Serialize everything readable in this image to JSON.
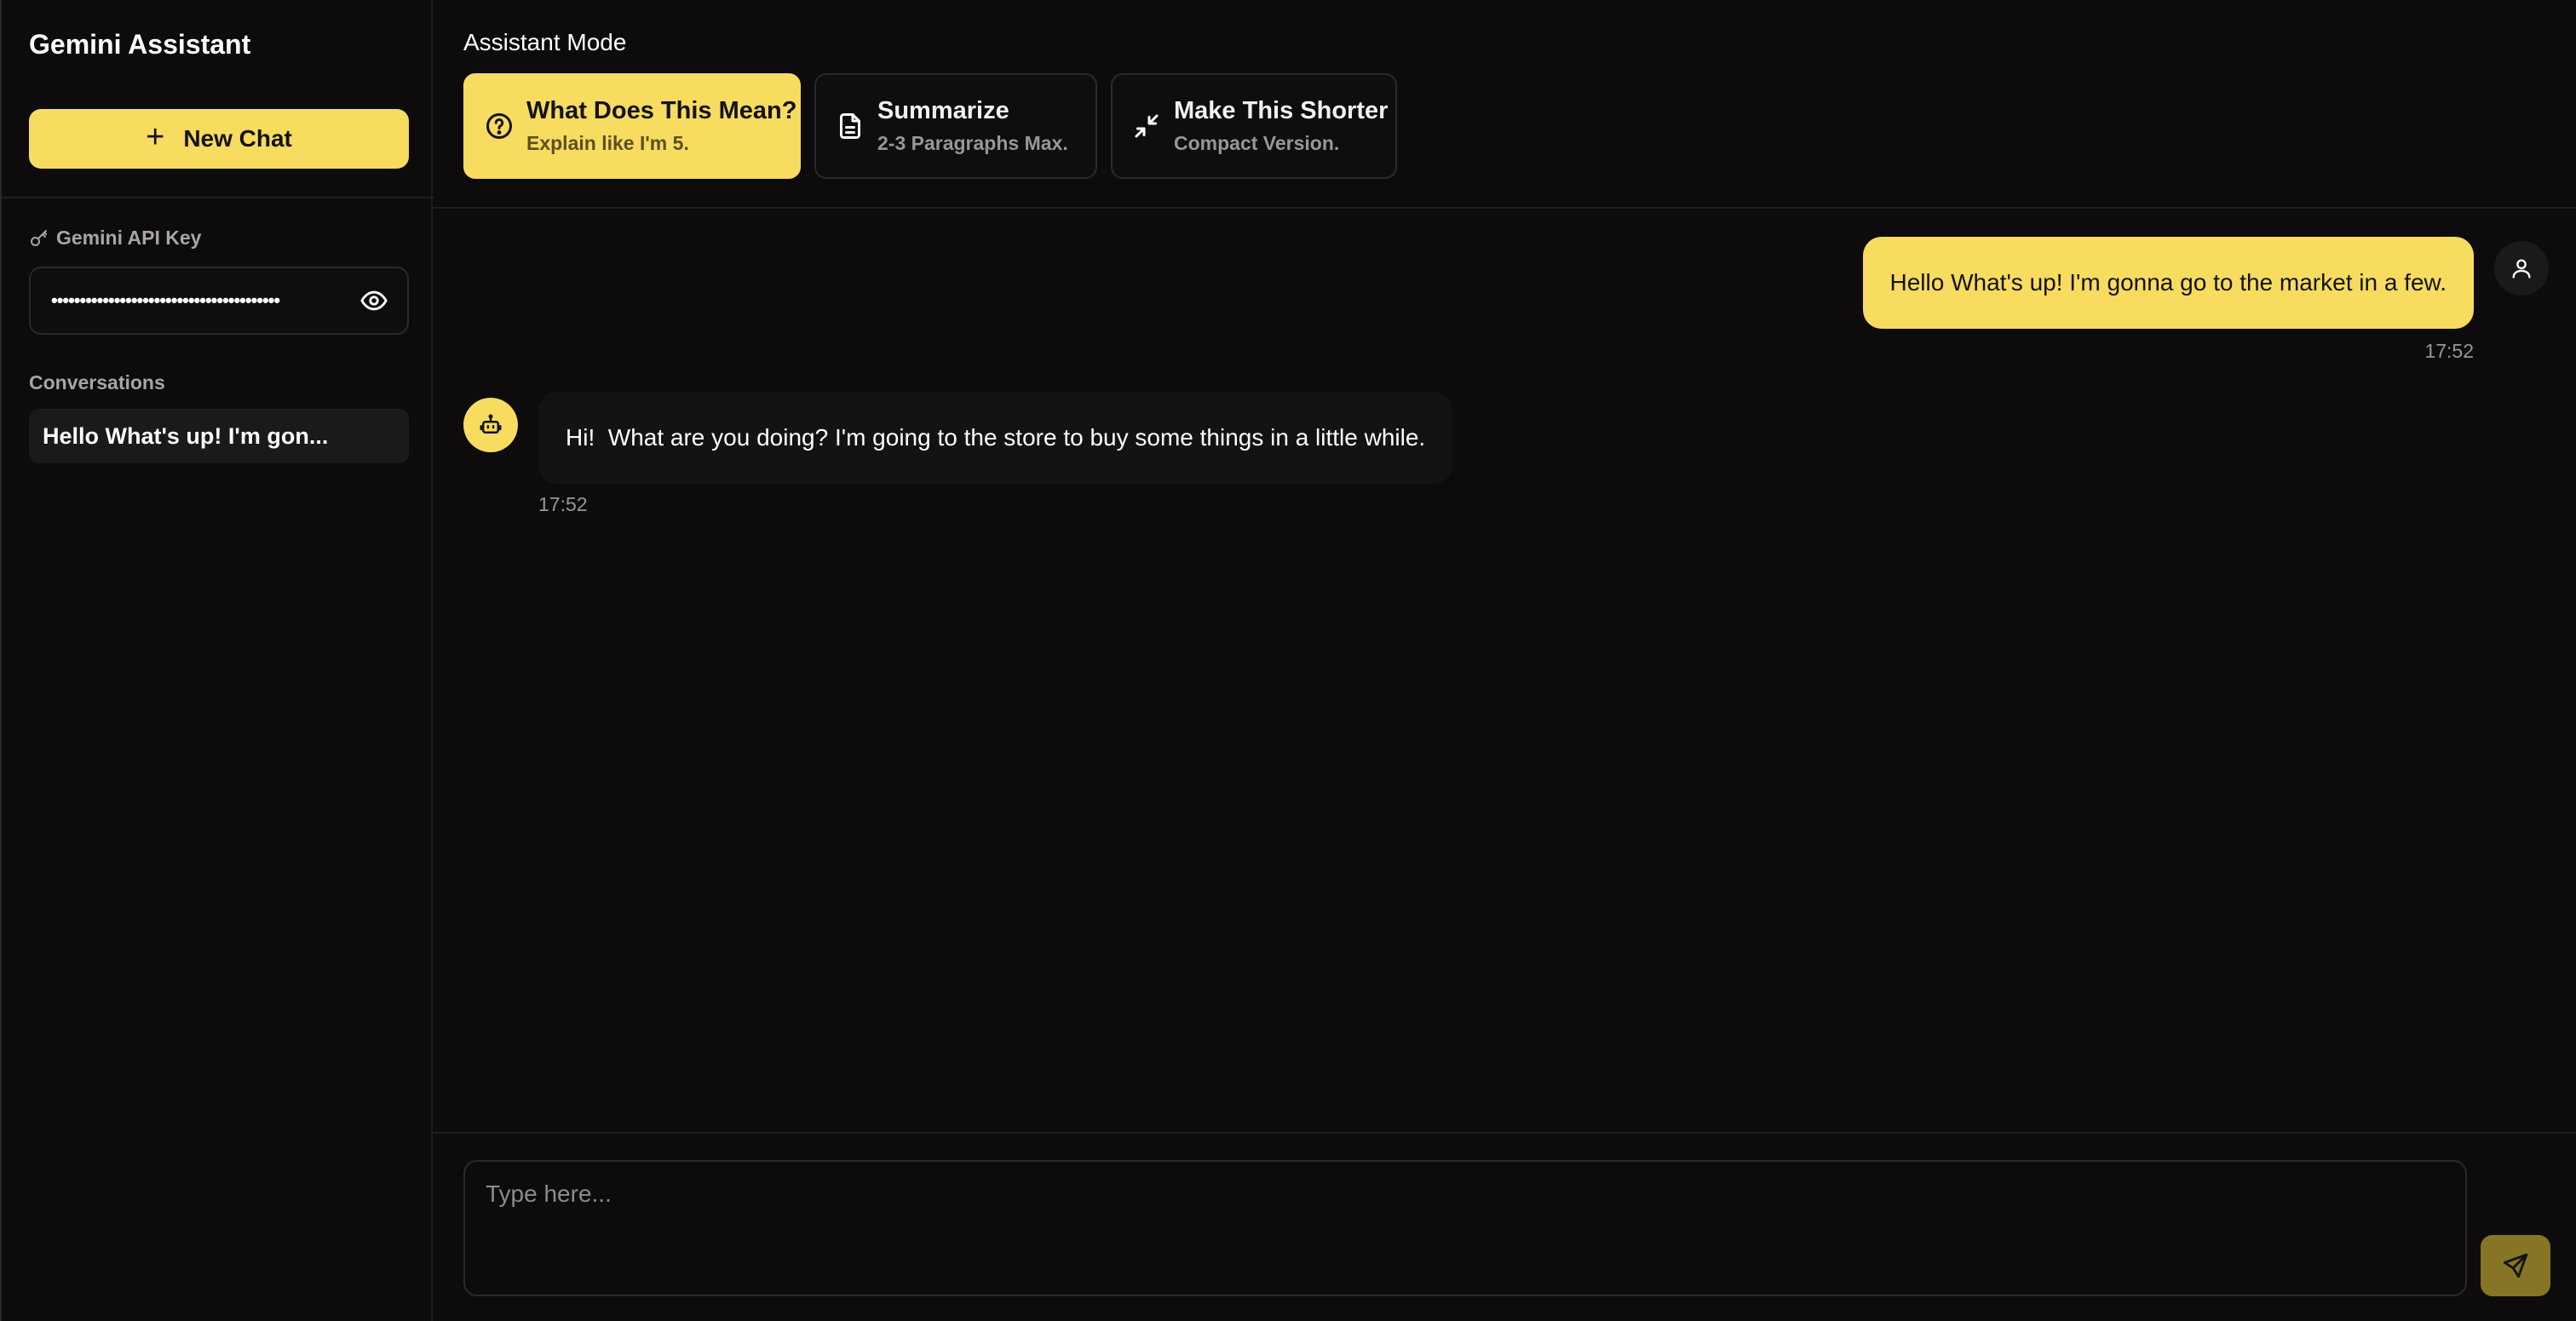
{
  "sidebar": {
    "title": "Gemini Assistant",
    "new_chat_label": "New Chat",
    "api_key_label": "Gemini API Key",
    "api_key_value": "••••••••••••••••••••••••••••••••••••••••",
    "conversations_label": "Conversations",
    "conversations": [
      {
        "title": "Hello What's up! I'm gon..."
      }
    ]
  },
  "modes": {
    "title": "Assistant Mode",
    "items": [
      {
        "title": "What Does This Mean?",
        "subtitle": "Explain like I'm 5.",
        "icon": "question-circle-icon",
        "active": true
      },
      {
        "title": "Summarize",
        "subtitle": "2-3 Paragraphs Max.",
        "icon": "document-icon",
        "active": false
      },
      {
        "title": "Make This Shorter",
        "subtitle": "Compact Version.",
        "icon": "compress-arrows-icon",
        "active": false
      }
    ]
  },
  "messages": [
    {
      "role": "user",
      "text": "Hello What's up! I'm gonna go to the market in a few.",
      "time": "17:52"
    },
    {
      "role": "assistant",
      "text": "Hi!  What are you doing? I'm going to the store to buy some things in a little while.",
      "time": "17:52"
    }
  ],
  "composer": {
    "placeholder": "Type here...",
    "send_icon": "send-icon"
  },
  "colors": {
    "accent": "#f7dc60",
    "background": "#0d0b0b"
  }
}
